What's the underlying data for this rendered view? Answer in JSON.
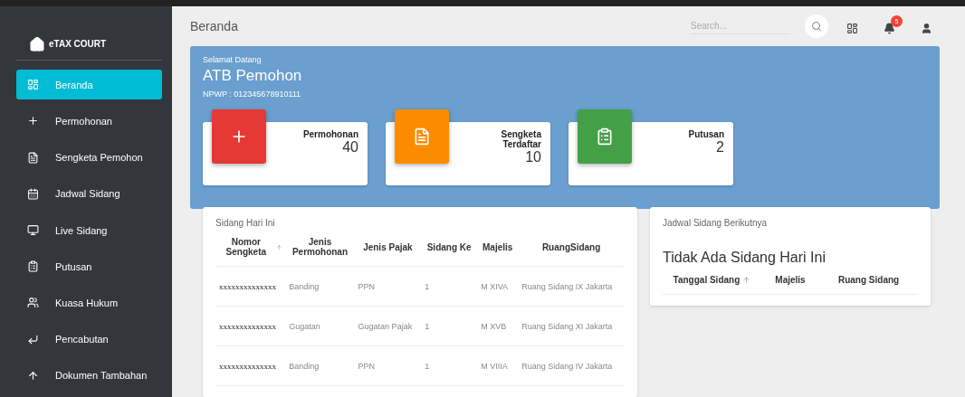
{
  "sidebar": {
    "logo": "eTAX COURT",
    "items": [
      {
        "label": "Beranda",
        "selected": true
      },
      {
        "label": "Permohonan",
        "selected": false
      },
      {
        "label": "Sengketa Pemohon",
        "selected": false
      },
      {
        "label": "Jadwal Sidang",
        "selected": false
      },
      {
        "label": "Live Sidang",
        "selected": false
      },
      {
        "label": "Putusan",
        "selected": false
      },
      {
        "label": "Kuasa Hukum",
        "selected": false
      },
      {
        "label": "Pencabutan",
        "selected": false
      },
      {
        "label": "Dokumen Tambahan",
        "selected": false
      }
    ]
  },
  "header": {
    "title": "Beranda",
    "search": {
      "placeholder": "Search..."
    },
    "notification_count": "5"
  },
  "banner": {
    "greeting": "Selamat Datang",
    "name": "ATB Pemohon",
    "npwp": "NPWP : 012345678910111"
  },
  "stats": [
    {
      "label": "Permohonan",
      "value": "40",
      "color": "#e53935"
    },
    {
      "label": "Sengketa Terdaftar",
      "value": "10",
      "color": "#fb8c00"
    },
    {
      "label": "Putusan",
      "value": "2",
      "color": "#43a047"
    }
  ],
  "today": {
    "title": "Sidang Hari Ini",
    "columns": [
      {
        "label": "Nomor Sengketa",
        "sorted": true
      },
      {
        "label": "Jenis Permohonan",
        "sorted": false
      },
      {
        "label": "Jenis Pajak",
        "sorted": false
      },
      {
        "label": "Sidang Ke",
        "sorted": false
      },
      {
        "label": "Majelis",
        "sorted": false
      },
      {
        "label": "RuangSidang",
        "sorted": false
      }
    ],
    "rows": [
      [
        "xxxxxxxxxxxxxx",
        "Banding",
        "PPN",
        "1",
        "M XIVA",
        "Ruang Sidang IX Jakarta"
      ],
      [
        "xxxxxxxxxxxxxx",
        "Gugatan",
        "Gugatan Pajak",
        "1",
        "M XVB",
        "Ruang Sidang XI Jakarta"
      ],
      [
        "xxxxxxxxxxxxxx",
        "Banding",
        "PPN",
        "1",
        "M VIIIA",
        "Ruang Sidang IV Jakarta"
      ]
    ]
  },
  "next": {
    "title": "Jadwal Sidang Berikutnya",
    "empty": "Tidak Ada Sidang Hari Ini",
    "columns": [
      {
        "label": "Tanggal Sidang",
        "sorted": true
      },
      {
        "label": "Majelis",
        "sorted": false
      },
      {
        "label": "Ruang Sidang",
        "sorted": false
      }
    ]
  }
}
